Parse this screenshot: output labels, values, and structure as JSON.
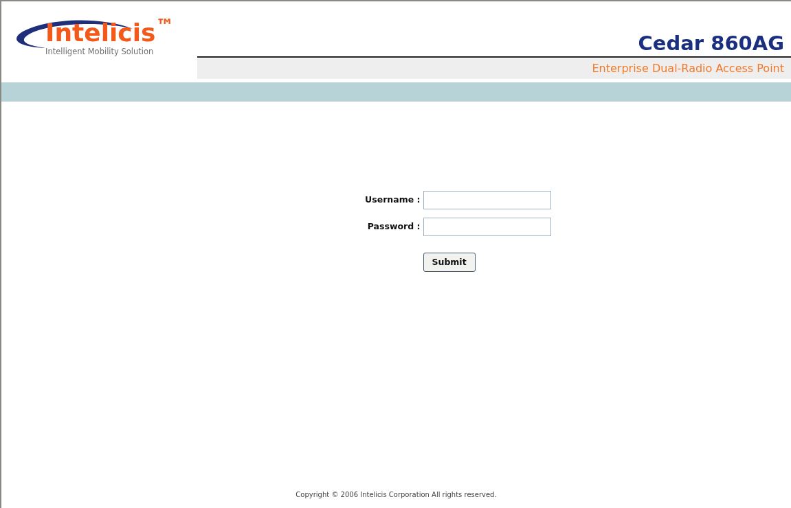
{
  "header": {
    "logo": {
      "name": "Intelicis$^{™}$",
      "tagline": "Intelligent Mobility Solution"
    },
    "product": "Cedar 860AG",
    "subtitle": "Enterprise Dual-Radio Access Point"
  },
  "login_form": {
    "fields": [
      {
        "label": "Username :"
      },
      {
        "label": "Password :"
      }
    ],
    "submit": "Submit"
  },
  "footer": {
    "copyright": "Copyright © 2006 Intelicis Corporation All rights reserved."
  }
}
